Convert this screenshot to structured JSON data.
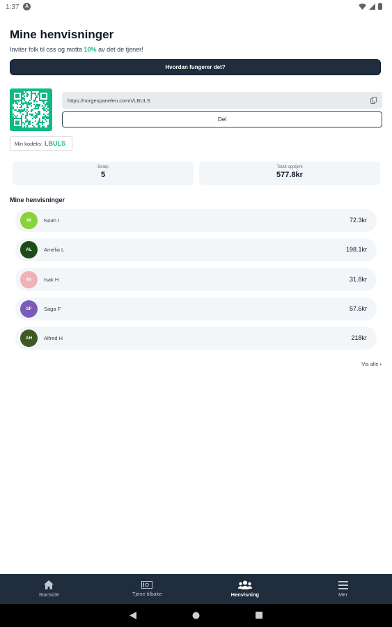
{
  "status_bar": {
    "time": "1:37"
  },
  "header": {
    "title": "Mine henvisninger",
    "subtitle_prefix": "Inviter folk til oss og motta ",
    "subtitle_percent": "10%",
    "subtitle_suffix": " av det de tjener!"
  },
  "how_button_label": "Hvordan fungerer det?",
  "share": {
    "url": "https://norgespanelen.com/r/LBULS",
    "share_button_label": "Del",
    "code_label": "Min kodeks:",
    "code": "LBULS"
  },
  "stats": [
    {
      "label": "Beløp",
      "value": "5"
    },
    {
      "label": "Totalt opptjent",
      "value": "577.8kr"
    }
  ],
  "referrals_title": "Mine henvisninger",
  "referrals": [
    {
      "initials": "NI",
      "name": "Noah I",
      "amount": "72.3kr",
      "color": "#8bd13a"
    },
    {
      "initials": "AL",
      "name": "Amelia L",
      "amount": "198.1kr",
      "color": "#1e4a16"
    },
    {
      "initials": "IH",
      "name": "Isak H",
      "amount": "31.8kr",
      "color": "#f0b2b6"
    },
    {
      "initials": "SF",
      "name": "Saga F",
      "amount": "57.6kr",
      "color": "#7a5cb8"
    },
    {
      "initials": "AH",
      "name": "Alfred H",
      "amount": "218kr",
      "color": "#3d5a22"
    }
  ],
  "see_all_label": "Vis alle",
  "bottom_nav": [
    {
      "label": "Startside",
      "icon": "home-icon"
    },
    {
      "label": "Tjene tilbake",
      "icon": "cash-icon"
    },
    {
      "label": "Henvisning",
      "icon": "group-icon",
      "active": true
    },
    {
      "label": "Mer",
      "icon": "menu-icon"
    }
  ],
  "colors": {
    "accent": "#10b981",
    "nav_bg": "#1f2d3d",
    "qr_bg": "#12b886"
  }
}
